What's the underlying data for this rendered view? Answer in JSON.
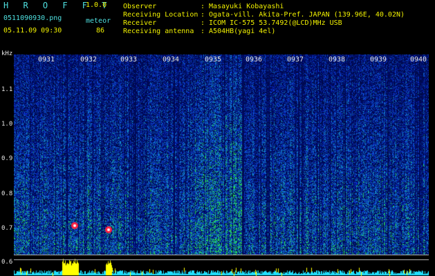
{
  "header": {
    "brand": "H R O F F T",
    "version": "1.0.0",
    "file_name": "0511090930.png",
    "meteor_label": "meteor",
    "date_time": "05.11.09 09:30",
    "meteor_count": "86"
  },
  "info": [
    {
      "label": "Observer",
      "value": ": Masayuki Kobayashi"
    },
    {
      "label": "Receiving Location",
      "value": ": Ogata-vill. Akita-Pref. JAPAN (139.96E, 40.02N)"
    },
    {
      "label": "Receiver",
      "value": ": ICOM IC-575 53.7492(@LCD)MHz USB"
    },
    {
      "label": "Receiving antenna",
      "value": ": A504HB(yagi 4el)"
    }
  ],
  "spectrogram": {
    "freq_unit": "kHz",
    "freq_ticks": [
      "1.1",
      "1.0",
      "0.9",
      "0.8",
      "0.7",
      "0.6"
    ],
    "time_ticks": [
      "0931",
      "0932",
      "0933",
      "0934",
      "0935",
      "0936",
      "0937",
      "0938",
      "0939",
      "0940"
    ]
  },
  "colors": {
    "header_cyan": "#4fe0e0",
    "header_yellow": "#f2f200",
    "background_blue": "#001060",
    "signal_green": "#30e030",
    "trace_yellow": "#ffff00",
    "trace_cyan": "#20e0ff"
  }
}
